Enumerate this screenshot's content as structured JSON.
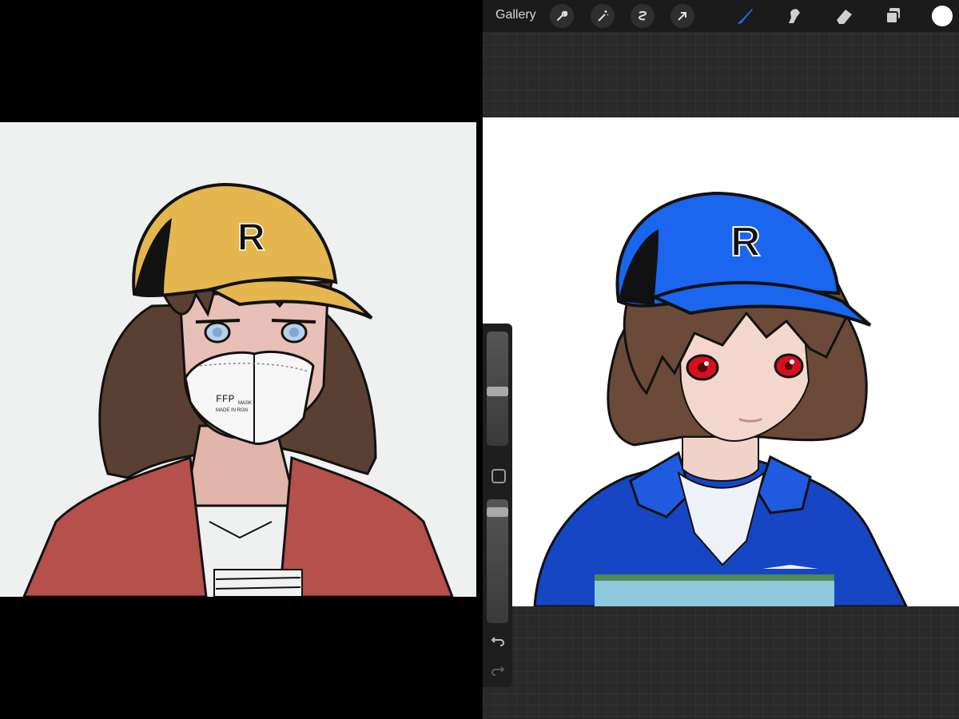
{
  "reference": {
    "cap_letter": "R",
    "mask_print_line1": "FFP",
    "mask_print_line2": "MASK",
    "mask_print_line3": "MADE IN RGN"
  },
  "procreate": {
    "gallery_label": "Gallery",
    "toolbar_icons": [
      "wrench-icon",
      "magic-wand-icon",
      "selection-icon",
      "transform-arrow-icon",
      "brush-icon",
      "smudge-icon",
      "eraser-icon",
      "layers-icon"
    ],
    "active_tool": "brush",
    "current_color": "#ffffff",
    "accent_color": "#1f6ff2"
  },
  "canvas_art": {
    "cap_letter": "R",
    "cap_color": "#1a66ee",
    "eye_color": "#d4101c"
  },
  "sidebar": {
    "brush_size_level": 0.47,
    "opacity_level": 0.07,
    "icons": [
      "modify-square-icon",
      "undo-icon",
      "redo-icon"
    ]
  }
}
